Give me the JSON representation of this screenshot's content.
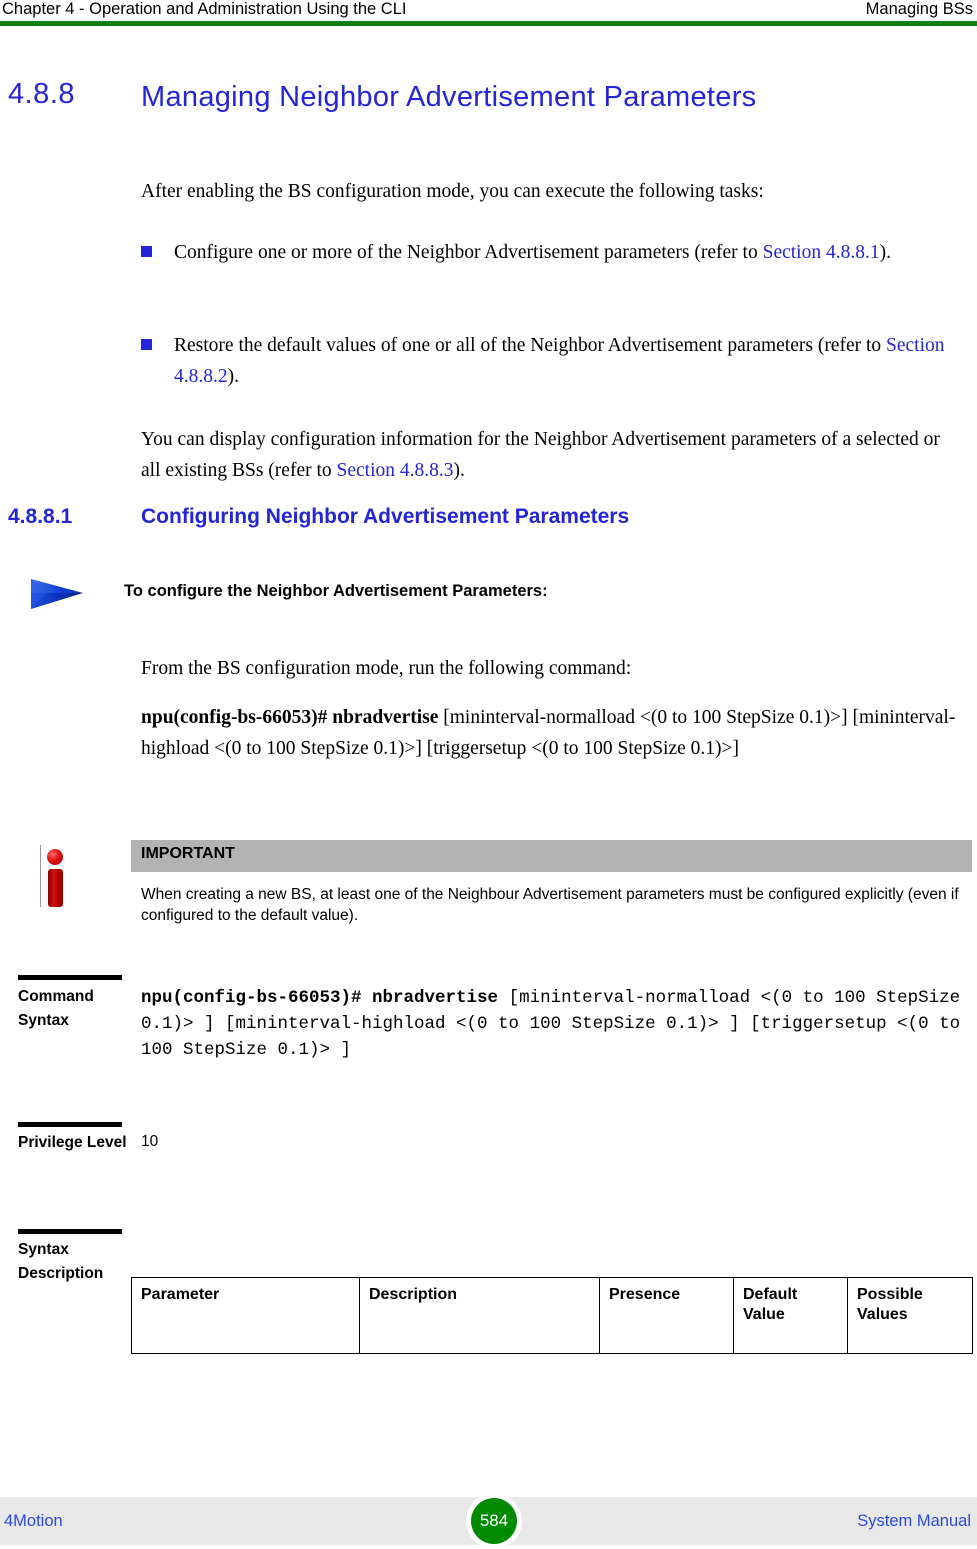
{
  "header": {
    "left": "Chapter 4 - Operation and Administration Using the CLI",
    "right": "Managing BSs",
    "rule_color": "#108010"
  },
  "section": {
    "number": "4.8.8",
    "title": "Managing Neighbor Advertisement Parameters",
    "intro": "After enabling the BS configuration mode, you can execute the following tasks:",
    "bullets": [
      {
        "text_before": "Configure one or more of the Neighbor Advertisement parameters (refer to ",
        "link": "Section 4.8.8.1",
        "text_after": ")."
      },
      {
        "text_before": "Restore the default values of one or all of the Neighbor Advertisement parameters (refer to ",
        "link": "Section 4.8.8.2",
        "text_after": ")."
      }
    ],
    "closing_before": "You can display configuration information for the Neighbor Advertisement parameters of a selected or all existing BSs (refer to ",
    "closing_link": "Section 4.8.8.3",
    "closing_after": ")."
  },
  "subsection": {
    "number": "4.8.8.1",
    "title": "Configuring Neighbor Advertisement Parameters",
    "procedure_title": "To configure the Neighbor Advertisement Parameters:",
    "procedure_intro": "From the BS configuration mode, run the following command:",
    "command_prompt": "npu(config-bs-66053)# nbradvertise",
    "command_args": " [mininterval-normalload <(0 to 100 StepSize 0.1)>] [mininterval-highload <(0 to 100 StepSize 0.1)>] [triggersetup <(0 to 100 StepSize 0.1)>]"
  },
  "note": {
    "label": "IMPORTANT",
    "body": "When creating a new BS, at least one of the Neighbour Advertisement parameters must be configured explicitly (even if configured to the default value).",
    "band_color": "#b3b3b3",
    "icon_color": "#d01414"
  },
  "fields": {
    "command_syntax": {
      "label": "Command Syntax",
      "value_bold": "npu(config-bs-66053)# nbradvertise",
      "value_rest": " [mininterval-normalload <(0 to 100 StepSize 0.1)> ] [mininterval-highload <(0 to 100 StepSize 0.1)> ] [triggersetup <(0 to 100 StepSize 0.1)> ]"
    },
    "privilege_level": {
      "label": "Privilege Level",
      "value": "10"
    },
    "syntax_description": {
      "label": "Syntax Description",
      "columns": [
        "Parameter",
        "Description",
        "Presence",
        "Default Value",
        "Possible Values"
      ],
      "rows": []
    }
  },
  "footer": {
    "left": "4Motion",
    "page": "584",
    "right": "System Manual",
    "page_color": "#008a00",
    "band_color": "#e8e8e8"
  }
}
